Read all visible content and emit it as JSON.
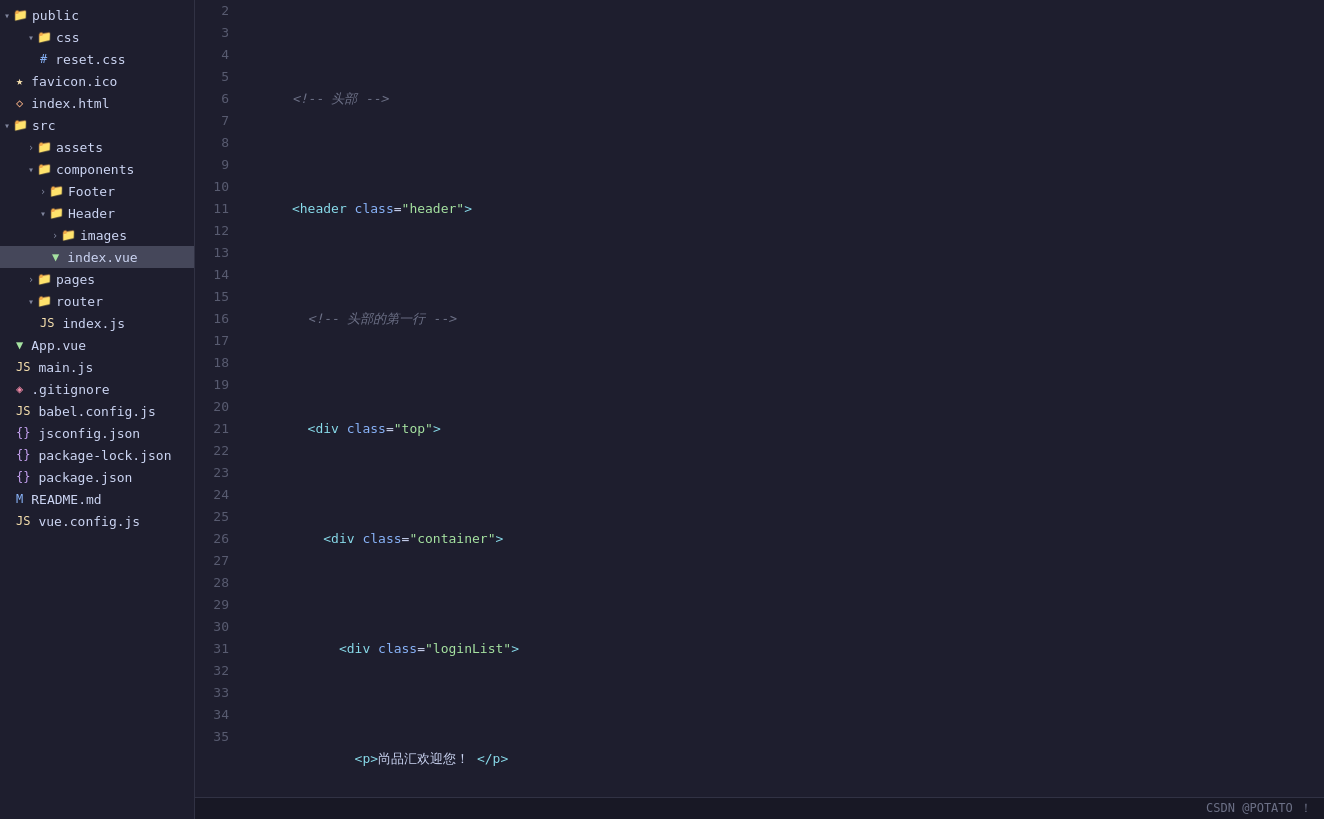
{
  "sidebar": {
    "items": [
      {
        "id": "public",
        "label": "public",
        "type": "folder-open",
        "indent": 0,
        "arrow": "▾"
      },
      {
        "id": "css",
        "label": "css",
        "type": "folder-open",
        "indent": 1,
        "arrow": "▾"
      },
      {
        "id": "reset.css",
        "label": "reset.css",
        "type": "css",
        "indent": 2
      },
      {
        "id": "favicon.ico",
        "label": "favicon.ico",
        "type": "star",
        "indent": 1
      },
      {
        "id": "index.html",
        "label": "index.html",
        "type": "html",
        "indent": 1
      },
      {
        "id": "src",
        "label": "src",
        "type": "folder-open",
        "indent": 0,
        "arrow": "▾"
      },
      {
        "id": "assets",
        "label": "assets",
        "type": "folder-closed",
        "indent": 1,
        "arrow": "›"
      },
      {
        "id": "components",
        "label": "components",
        "type": "folder-open",
        "indent": 1,
        "arrow": "▾"
      },
      {
        "id": "Footer",
        "label": "Footer",
        "type": "folder-closed",
        "indent": 2,
        "arrow": "›"
      },
      {
        "id": "Header",
        "label": "Header",
        "type": "folder-open",
        "indent": 2,
        "arrow": "▾"
      },
      {
        "id": "images",
        "label": "images",
        "type": "folder-closed",
        "indent": 3,
        "arrow": "›"
      },
      {
        "id": "index.vue",
        "label": "index.vue",
        "type": "vue",
        "indent": 3,
        "active": true
      },
      {
        "id": "pages",
        "label": "pages",
        "type": "folder-closed",
        "indent": 1,
        "arrow": "›"
      },
      {
        "id": "router",
        "label": "router",
        "type": "folder-open",
        "indent": 1,
        "arrow": "▾"
      },
      {
        "id": "index.js",
        "label": "index.js",
        "type": "js",
        "indent": 2
      },
      {
        "id": "App.vue",
        "label": "App.vue",
        "type": "vue",
        "indent": 0
      },
      {
        "id": "main.js",
        "label": "main.js",
        "type": "js",
        "indent": 0
      },
      {
        "id": ".gitignore",
        "label": ".gitignore",
        "type": "git",
        "indent": 0
      },
      {
        "id": "babel.config.js",
        "label": "babel.config.js",
        "type": "babel",
        "indent": 0
      },
      {
        "id": "jsconfig.json",
        "label": "jsconfig.json",
        "type": "json",
        "indent": 0
      },
      {
        "id": "package-lock.json",
        "label": "package-lock.json",
        "type": "json",
        "indent": 0
      },
      {
        "id": "package.json",
        "label": "package.json",
        "type": "json",
        "indent": 0
      },
      {
        "id": "README.md",
        "label": "README.md",
        "type": "readme",
        "indent": 0
      },
      {
        "id": "vue.config.js",
        "label": "vue.config.js",
        "type": "js",
        "indent": 0
      }
    ]
  },
  "status_bar": {
    "text": "CSDN @POTATO ！"
  },
  "line_highlight": 18
}
